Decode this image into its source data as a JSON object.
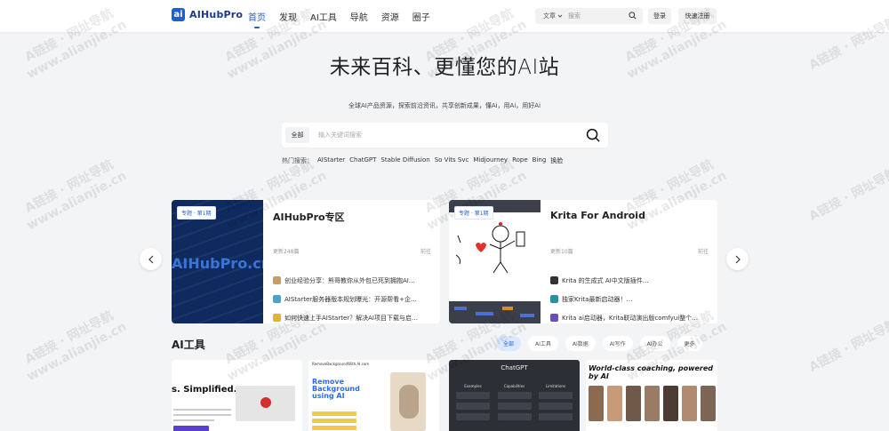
{
  "header": {
    "logo_mark": "ai",
    "logo_text": "AIHubPro",
    "nav": [
      "首页",
      "发现",
      "AI工具",
      "导航",
      "资源",
      "圈子"
    ],
    "search_type": "文章",
    "search_placeholder": "搜索",
    "login": "登录",
    "register": "快速注册"
  },
  "hero": {
    "title": "未来百科、更懂您的AI站",
    "subtitle": "全球AI产品资源，探索前沿资讯，共享创新成果，懂Ai，用Ai，用好Ai",
    "search_type": "全部",
    "search_placeholder": "输入关键词搜索",
    "hot_label": "热门搜索：",
    "hot_tags": [
      "AIStarter",
      "ChatGPT",
      "Stable Diffusion",
      "So Vits Svc",
      "Midjourney",
      "Rope",
      "Bing",
      "换脸"
    ]
  },
  "carousel": [
    {
      "badge": "专题 · 第1期",
      "thumb_text": "AIHubPro.cn",
      "title": "AIHubPro专区",
      "meta_left": "更新248篇",
      "meta_right": "前往",
      "items": [
        "创业经验分享：熊哥教你从外包已死到拥抱AI…",
        "AIStarter服务器版本规划曝光：开源帮看+企…",
        "如何快速上手AIStarter？解决AI项目下载与启…"
      ]
    },
    {
      "badge": "专题 · 第1期",
      "title": "Krita For Android",
      "meta_left": "更新10篇",
      "meta_right": "前往",
      "items": [
        "Krita 的生成式 AI中文版插件…",
        "独家Krita最新启动器！…",
        "Krita ai启动器，Krita联动演出版comfyui整个…"
      ]
    }
  ],
  "ai_tools": {
    "title": "AI工具",
    "tabs": [
      "全部",
      "AI工具",
      "AI数据",
      "AI写作",
      "AI办公",
      "更多"
    ],
    "active_tab": "全部",
    "tool1_headline": "s. Simplified.",
    "tool2_top": "RemoveBackgroundWith.AI.com",
    "tool2_headline": "Remove Background using AI",
    "tool3_title": "ChatGPT",
    "tool3_cols": [
      "Examples",
      "Capabilities",
      "Limitations"
    ],
    "tool4_title": "World-class coaching, powered by AI"
  },
  "watermark": {
    "line1": "A链接 · 网址导航",
    "line2": "www.alianjie.cn"
  },
  "colors": {
    "brand": "#1e5fcf",
    "page_bg": "#f3f4f6",
    "tab_active_bg": "#dbe8ff"
  }
}
